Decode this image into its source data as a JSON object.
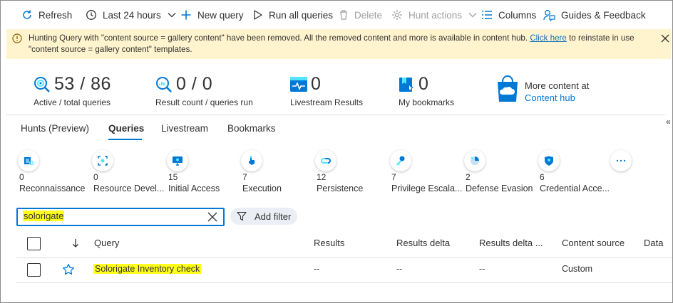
{
  "toolbar": {
    "refresh": "Refresh",
    "time_range": "Last 24 hours",
    "new_query": "New query",
    "run_all": "Run all queries",
    "delete": "Delete",
    "hunt_actions": "Hunt actions",
    "columns": "Columns",
    "guides": "Guides & Feedback"
  },
  "banner": {
    "message": "Hunting Query with \"content source = gallery content\" have been removed. All the removed content and more is available in content hub. ",
    "link": "Click here",
    "message_end": " to reinstate in use \"content source = gallery content\" templates."
  },
  "stats": {
    "active_total": {
      "value": "53 / 86",
      "label": "Active / total queries"
    },
    "result_count": {
      "value": "0 / 0",
      "label": "Result count / queries run"
    },
    "livestream": {
      "value": "0",
      "label": "Livestream Results"
    },
    "bookmarks": {
      "value": "0",
      "label": "My bookmarks"
    },
    "content_hub": {
      "label": "More content at",
      "link": "Content hub"
    }
  },
  "tabs": [
    "Hunts (Preview)",
    "Queries",
    "Livestream",
    "Bookmarks"
  ],
  "active_tab": "Queries",
  "tactics": [
    {
      "count": "0",
      "name": "Reconnaissance"
    },
    {
      "count": "0",
      "name": "Resource Devel..."
    },
    {
      "count": "15",
      "name": "Initial Access"
    },
    {
      "count": "7",
      "name": "Execution"
    },
    {
      "count": "12",
      "name": "Persistence"
    },
    {
      "count": "7",
      "name": "Privilege Escala..."
    },
    {
      "count": "2",
      "name": "Defense Evasion"
    },
    {
      "count": "6",
      "name": "Credential Acce..."
    },
    {
      "count": "",
      "name": ""
    }
  ],
  "search": {
    "value": "solorigate"
  },
  "add_filter": "Add filter",
  "table": {
    "columns": [
      "Query",
      "Results",
      "Results delta",
      "Results delta ...",
      "Content source",
      "Data"
    ],
    "rows": [
      {
        "query": "Solorigate Inventory check",
        "results": "--",
        "delta": "--",
        "delta_pct": "--",
        "source": "Custom"
      }
    ]
  },
  "colors": {
    "accent": "#0078d4",
    "highlight": "#ffff1a",
    "banner": "#fff4ce"
  }
}
